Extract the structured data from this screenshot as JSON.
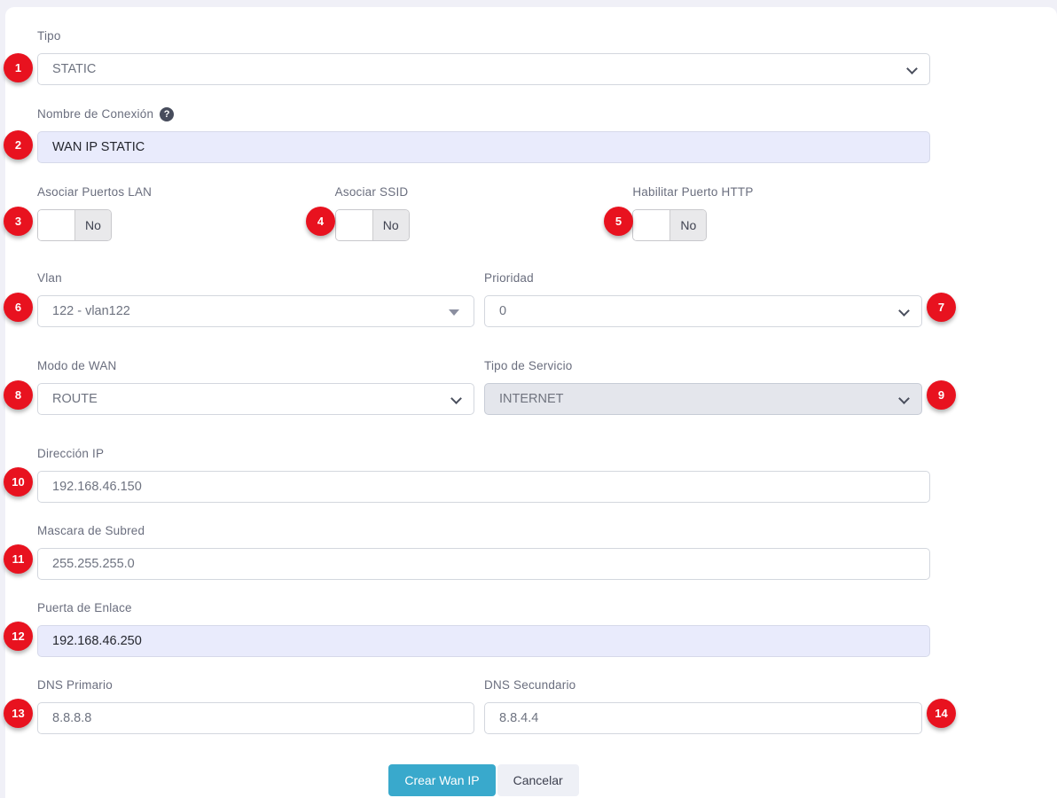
{
  "colors": {
    "badge_red": "#e8121f",
    "primary_button": "#39a9cc",
    "autofill_background": "#e9ebfc",
    "disabled_background": "#e4e6ec",
    "page_background": "#f0f0f7"
  },
  "fields": {
    "tipo": {
      "label": "Tipo",
      "value": "STATIC"
    },
    "nombre_conexion": {
      "label": "Nombre de Conexión",
      "help_glyph": "?",
      "value": "WAN IP STATIC"
    },
    "asociar_puertos_lan": {
      "label": "Asociar Puertos LAN",
      "value": "No"
    },
    "asociar_ssid": {
      "label": "Asociar SSID",
      "value": "No"
    },
    "habilitar_puerto_http": {
      "label": "Habilitar Puerto HTTP",
      "value": "No"
    },
    "vlan": {
      "label": "Vlan",
      "value": "122 - vlan122"
    },
    "prioridad": {
      "label": "Prioridad",
      "value": "0"
    },
    "modo_wan": {
      "label": "Modo de WAN",
      "value": "ROUTE"
    },
    "tipo_servicio": {
      "label": "Tipo de Servicio",
      "value": "INTERNET",
      "disabled": true
    },
    "direccion_ip": {
      "label": "Dirección IP",
      "value": "192.168.46.150"
    },
    "mascara_subred": {
      "label": "Mascara de Subred",
      "value": "255.255.255.0"
    },
    "puerta_enlace": {
      "label": "Puerta de Enlace",
      "value": "192.168.46.250"
    },
    "dns_primario": {
      "label": "DNS Primario",
      "value": "8.8.8.8"
    },
    "dns_secundario": {
      "label": "DNS Secundario",
      "value": "8.8.4.4"
    }
  },
  "buttons": {
    "submit": "Crear Wan IP",
    "cancel": "Cancelar"
  },
  "annotations": [
    "1",
    "2",
    "3",
    "4",
    "5",
    "6",
    "7",
    "8",
    "9",
    "10",
    "11",
    "12",
    "13",
    "14"
  ]
}
